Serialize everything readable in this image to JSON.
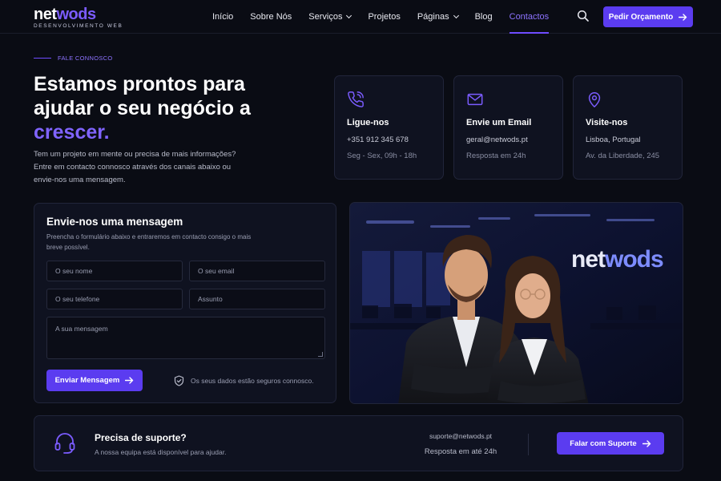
{
  "brand": {
    "name_part1": "net",
    "name_part2": "wods",
    "tagline": "DESENVOLVIMENTO WEB"
  },
  "nav": {
    "items": [
      {
        "label": "Início"
      },
      {
        "label": "Sobre Nós"
      },
      {
        "label": "Serviços"
      },
      {
        "label": "Projetos"
      },
      {
        "label": "Páginas"
      },
      {
        "label": "Blog"
      },
      {
        "label": "Contactos"
      }
    ],
    "active": "Contactos",
    "cta_label": "Pedir Orçamento"
  },
  "hero": {
    "eyebrow": "FALE CONNOSCO",
    "title_part1": "Estamos prontos para ajudar o seu negócio a",
    "title_accent": "crescer.",
    "description": "Tem um projeto em mente ou precisa de mais informações? Entre em contacto connosco através dos canais abaixo ou envie-nos uma mensagem."
  },
  "cards": [
    {
      "icon": "phone-icon",
      "title": "Ligue-nos",
      "line1": "+351 912 345 678",
      "line2": "Seg - Sex, 09h - 18h"
    },
    {
      "icon": "mail-icon",
      "title": "Envie um Email",
      "line1": "geral@netwods.pt",
      "line2": "Resposta em 24h"
    },
    {
      "icon": "map-pin-icon",
      "title": "Visite-nos",
      "line1": "Lisboa, Portugal",
      "line2": "Av. da Liberdade, 245"
    }
  ],
  "form": {
    "title": "Envie-nos uma mensagem",
    "subtitle": "Preencha o formulário abaixo e entraremos em contacto consigo o mais breve possível.",
    "placeholders": {
      "name": "O seu nome",
      "email": "O seu email",
      "phone": "O seu telefone",
      "subject": "Assunto",
      "message": "A sua mensagem"
    },
    "submit_label": "Enviar Mensagem",
    "secure_note": "Os seus dados estão seguros connosco."
  },
  "photo": {
    "wall_logo_part1": "net",
    "wall_logo_part2": "wods"
  },
  "support": {
    "title": "Precisa de suporte?",
    "subtitle": "A nossa equipa está disponível para ajudar.",
    "email": "suporte@netwods.pt",
    "response": "Resposta em até 24h",
    "button_label": "Falar com Suporte"
  },
  "colors": {
    "accent": "#5b3cf0",
    "accent_text": "#8064ff",
    "background": "#0a0c14",
    "card": "#0f1220"
  }
}
